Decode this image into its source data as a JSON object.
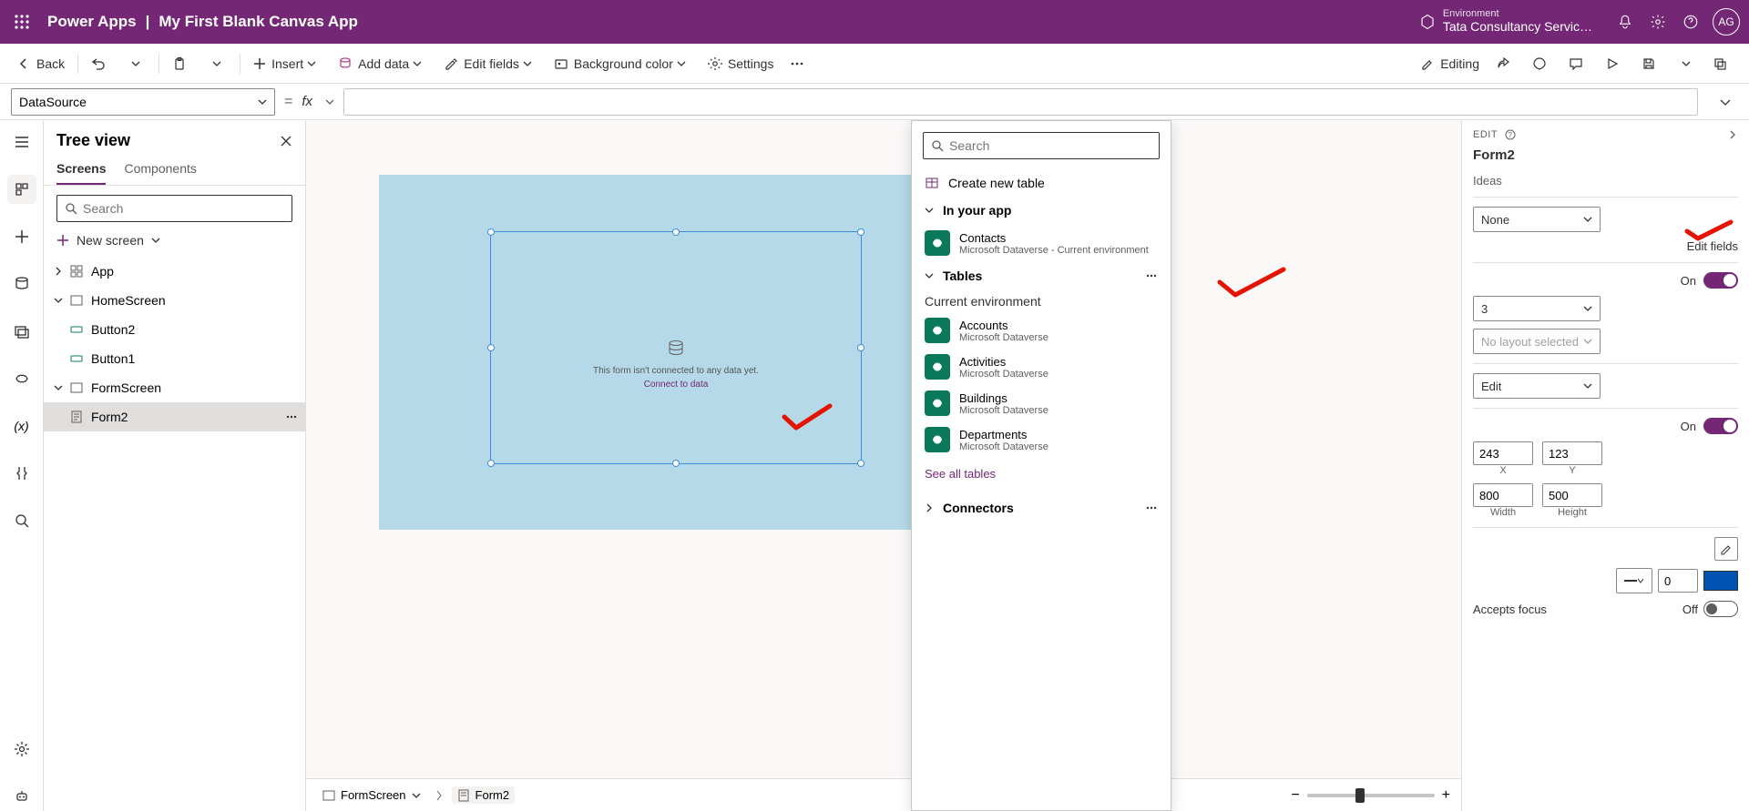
{
  "header": {
    "product": "Power Apps",
    "sep": "|",
    "app_name": "My First Blank Canvas App",
    "env_label": "Environment",
    "env_name": "Tata Consultancy Servic…",
    "avatar": "AG"
  },
  "cmdbar": {
    "back": "Back",
    "insert": "Insert",
    "add_data": "Add data",
    "edit_fields": "Edit fields",
    "bg_color": "Background color",
    "settings": "Settings",
    "editing": "Editing"
  },
  "formula": {
    "property": "DataSource",
    "value": ""
  },
  "tree": {
    "title": "Tree view",
    "tabs": {
      "screens": "Screens",
      "components": "Components"
    },
    "search_placeholder": "Search",
    "new_screen": "New screen",
    "items": {
      "app": "App",
      "home": "HomeScreen",
      "button2": "Button2",
      "button1": "Button1",
      "formscreen": "FormScreen",
      "form2": "Form2"
    }
  },
  "canvas": {
    "form_empty_line1": "This form isn't connected to any data yet.",
    "form_empty_link": "Connect to data",
    "footer_screen": "FormScreen",
    "footer_form": "Form2"
  },
  "ds_popup": {
    "search_placeholder": "Search",
    "create": "Create new table",
    "in_app": "In your app",
    "contacts": {
      "name": "Contacts",
      "src": "Microsoft Dataverse - Current environment"
    },
    "tables_section": "Tables",
    "current_env": "Current environment",
    "tables": [
      {
        "name": "Accounts",
        "src": "Microsoft Dataverse"
      },
      {
        "name": "Activities",
        "src": "Microsoft Dataverse"
      },
      {
        "name": "Buildings",
        "src": "Microsoft Dataverse"
      },
      {
        "name": "Departments",
        "src": "Microsoft Dataverse"
      }
    ],
    "see_all": "See all tables",
    "connectors": "Connectors"
  },
  "props": {
    "edit": "EDIT",
    "title": "Form2",
    "ideas": "Ideas",
    "datasource": "None",
    "edit_fields": "Edit fields",
    "snap_on": "On",
    "columns": "3",
    "layout": "No layout selected",
    "mode": "Edit",
    "visible_on": "On",
    "x": "243",
    "y": "123",
    "x_lbl": "X",
    "y_lbl": "Y",
    "w": "800",
    "h": "500",
    "w_lbl": "Width",
    "h_lbl": "Height",
    "border_width": "0",
    "accepts_focus": "Accepts focus",
    "off": "Off"
  }
}
